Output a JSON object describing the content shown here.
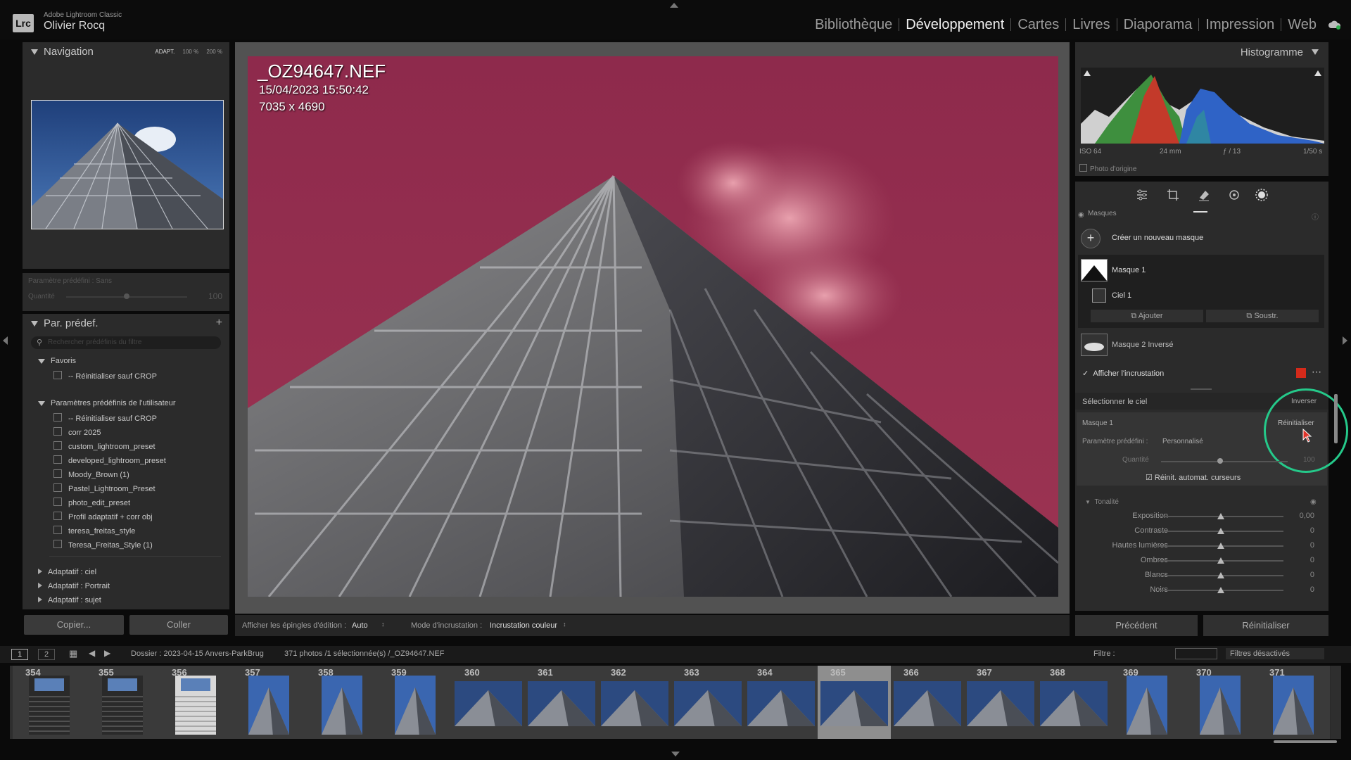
{
  "app": {
    "logo": "Lrc",
    "product": "Adobe Lightroom Classic",
    "user": "Olivier Rocq"
  },
  "modules": [
    {
      "label": "Bibliothèque",
      "active": false
    },
    {
      "label": "Développement",
      "active": true
    },
    {
      "label": "Cartes",
      "active": false
    },
    {
      "label": "Livres",
      "active": false
    },
    {
      "label": "Diaporama",
      "active": false
    },
    {
      "label": "Impression",
      "active": false
    },
    {
      "label": "Web",
      "active": false
    }
  ],
  "navigator": {
    "title": "Navigation",
    "zoom_fit": "ADAPT.",
    "zoom_100": "100 %",
    "zoom_200": "200 %"
  },
  "preset_amount": {
    "label": "Paramètre prédéfini : Sans",
    "amount_label": "Quantité",
    "amount_value": "100"
  },
  "presets": {
    "title": "Par. prédef.",
    "add": "+",
    "search_placeholder": "Rechercher prédéfinis du filtre",
    "groups": [
      {
        "name": "Favoris",
        "expanded": true,
        "items": [
          "-- Réinitialiser sauf CROP"
        ]
      },
      {
        "name": "Paramètres prédéfinis de l'utilisateur",
        "expanded": true,
        "items": [
          "-- Réinitialiser sauf CROP",
          "corr 2025",
          "custom_lightroom_preset",
          "developed_lightroom_preset",
          "Moody_Brown (1)",
          "Pastel_Lightroom_Preset",
          "photo_edit_preset",
          "Profil adaptatif + corr obj",
          "teresa_freitas_style",
          "Teresa_Freitas_Style (1)"
        ]
      },
      {
        "name": "Adaptatif : ciel",
        "expanded": false,
        "items": []
      },
      {
        "name": "Adaptatif : Portrait",
        "expanded": false,
        "items": []
      },
      {
        "name": "Adaptatif : sujet",
        "expanded": false,
        "items": []
      }
    ]
  },
  "left_buttons": {
    "copy": "Copier...",
    "paste": "Coller"
  },
  "photo": {
    "filename": "_OZ94647.NEF",
    "datetime": "15/04/2023 15:50:42",
    "dimensions": "7035 x 4690"
  },
  "toolbar": {
    "pins_label": "Afficher les épingles d'édition :",
    "pins_value": "Auto",
    "overlay_label": "Mode d'incrustation :",
    "overlay_value": "Incrustation couleur"
  },
  "histogram": {
    "title": "Histogramme",
    "iso": "ISO 64",
    "focal": "24 mm",
    "aperture": "ƒ / 13",
    "shutter": "1/50 s",
    "original_photo": "Photo d'origine"
  },
  "masks": {
    "section": "Masques",
    "create": "Créer un nouveau masque",
    "mask1": "Masque 1",
    "sky": "Ciel 1",
    "add": "Ajouter",
    "subtract": "Soustr.",
    "mask2": "Masque 2 Inversé",
    "show_overlay": "Afficher l'incrustation",
    "overlay_color": "#d42a1a"
  },
  "mask_settings": {
    "title": "Sélectionner le ciel",
    "invert": "Inverser",
    "mask_name": "Masque 1",
    "reset": "Réinitialiser",
    "preset_label": "Paramètre prédéfini :",
    "preset_value": "Personnalisé",
    "amount_label": "Quantité",
    "amount_value": "100",
    "auto_reset": "Réinit. automat. curseurs"
  },
  "tone": {
    "title": "Tonalité",
    "sliders": [
      {
        "label": "Exposition",
        "value": "0,00"
      },
      {
        "label": "Contraste",
        "value": "0"
      },
      {
        "label": "Hautes lumières",
        "value": "0"
      },
      {
        "label": "Ombres",
        "value": "0"
      },
      {
        "label": "Blancs",
        "value": "0"
      },
      {
        "label": "Noirs",
        "value": "0"
      }
    ]
  },
  "right_buttons": {
    "previous": "Précédent",
    "reset": "Réinitialiser"
  },
  "filmstrip_bar": {
    "view1": "1",
    "view2": "2",
    "folder": "Dossier : 2023-04-15 Anvers-ParkBrug",
    "count": "371 photos /1 sélectionnée(s) /_OZ94647.NEF",
    "filter_label": "Filtre :",
    "filter_value": "Filtres désactivés"
  },
  "filmstrip": [
    {
      "num": "354",
      "style": "stairs"
    },
    {
      "num": "355",
      "style": "stairs"
    },
    {
      "num": "356",
      "style": "stairs2"
    },
    {
      "num": "357",
      "style": "tower"
    },
    {
      "num": "358",
      "style": "tower"
    },
    {
      "num": "359",
      "style": "tower"
    },
    {
      "num": "360",
      "style": "wide"
    },
    {
      "num": "361",
      "style": "wide"
    },
    {
      "num": "362",
      "style": "wide"
    },
    {
      "num": "363",
      "style": "wide"
    },
    {
      "num": "364",
      "style": "wide"
    },
    {
      "num": "365",
      "style": "wide",
      "selected": true
    },
    {
      "num": "366",
      "style": "wide"
    },
    {
      "num": "367",
      "style": "wide"
    },
    {
      "num": "368",
      "style": "wide"
    },
    {
      "num": "369",
      "style": "tower"
    },
    {
      "num": "370",
      "style": "tower"
    },
    {
      "num": "371",
      "style": "tower"
    }
  ]
}
